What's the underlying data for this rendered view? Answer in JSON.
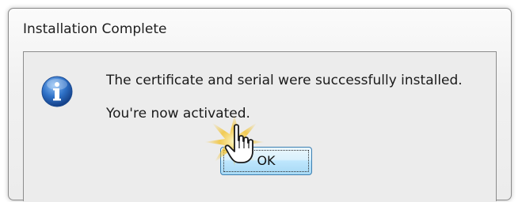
{
  "dialog": {
    "title": "Installation Complete",
    "message_line_1": "The certificate and serial were successfully installed.",
    "message_line_2": "You're now activated.",
    "ok_label": "OK",
    "icon": "information-icon",
    "cursor": "hand-pointer-icon"
  },
  "colors": {
    "icon_blue": "#1f5fb4",
    "button_border": "#3c7fb1",
    "click_highlight": "#f2c230"
  }
}
